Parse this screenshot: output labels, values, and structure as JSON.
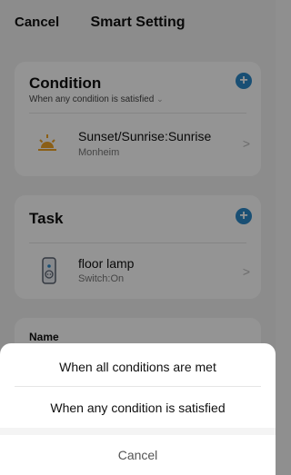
{
  "header": {
    "cancel_label": "Cancel",
    "title": "Smart Setting"
  },
  "condition": {
    "title": "Condition",
    "mode_text": "When any condition is satisfied",
    "mode_caret": "⌄",
    "add_icon": "plus-icon",
    "items": [
      {
        "title": "Sunset/Sunrise:Sunrise",
        "subtitle": "Monheim",
        "icon": "sunrise-icon"
      }
    ]
  },
  "task": {
    "title": "Task",
    "add_icon": "plus-icon",
    "items": [
      {
        "title": "floor lamp",
        "subtitle": "Switch:On",
        "icon": "plug-icon"
      }
    ]
  },
  "name_section": {
    "label": "Name"
  },
  "sheet": {
    "options": [
      "When all conditions are met",
      "When any condition is satisfied"
    ],
    "cancel_label": "Cancel"
  },
  "colors": {
    "accent": "#2b88c9",
    "sun": "#f0a426"
  }
}
